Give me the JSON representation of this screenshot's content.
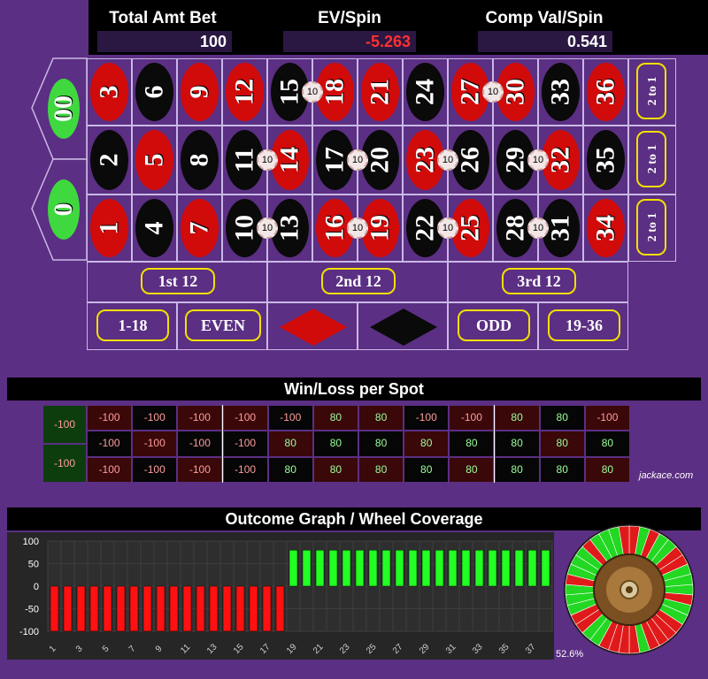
{
  "header": {
    "total_label": "Total Amt Bet",
    "total_value": "100",
    "ev_label": "EV/Spin",
    "ev_value": "-5.263",
    "comp_label": "Comp Val/Spin",
    "comp_value": "0.541"
  },
  "table": {
    "zeros": [
      "00",
      "0"
    ],
    "columns": [
      [
        {
          "n": "3",
          "c": "red"
        },
        {
          "n": "2",
          "c": "black"
        },
        {
          "n": "1",
          "c": "red"
        }
      ],
      [
        {
          "n": "6",
          "c": "black"
        },
        {
          "n": "5",
          "c": "red"
        },
        {
          "n": "4",
          "c": "black"
        }
      ],
      [
        {
          "n": "9",
          "c": "red"
        },
        {
          "n": "8",
          "c": "black"
        },
        {
          "n": "7",
          "c": "red"
        }
      ],
      [
        {
          "n": "12",
          "c": "red"
        },
        {
          "n": "11",
          "c": "black"
        },
        {
          "n": "10",
          "c": "black"
        }
      ],
      [
        {
          "n": "15",
          "c": "black"
        },
        {
          "n": "14",
          "c": "red"
        },
        {
          "n": "13",
          "c": "black"
        }
      ],
      [
        {
          "n": "18",
          "c": "red"
        },
        {
          "n": "17",
          "c": "black"
        },
        {
          "n": "16",
          "c": "red"
        }
      ],
      [
        {
          "n": "21",
          "c": "red"
        },
        {
          "n": "20",
          "c": "black"
        },
        {
          "n": "19",
          "c": "red"
        }
      ],
      [
        {
          "n": "24",
          "c": "black"
        },
        {
          "n": "23",
          "c": "red"
        },
        {
          "n": "22",
          "c": "black"
        }
      ],
      [
        {
          "n": "27",
          "c": "red"
        },
        {
          "n": "26",
          "c": "black"
        },
        {
          "n": "25",
          "c": "red"
        }
      ],
      [
        {
          "n": "30",
          "c": "red"
        },
        {
          "n": "29",
          "c": "black"
        },
        {
          "n": "28",
          "c": "black"
        }
      ],
      [
        {
          "n": "33",
          "c": "black"
        },
        {
          "n": "32",
          "c": "red"
        },
        {
          "n": "31",
          "c": "black"
        }
      ],
      [
        {
          "n": "36",
          "c": "red"
        },
        {
          "n": "35",
          "c": "black"
        },
        {
          "n": "34",
          "c": "red"
        }
      ]
    ],
    "column_bets": [
      "2 to 1",
      "2 to 1",
      "2 to 1"
    ],
    "dozens": [
      "1st 12",
      "2nd 12",
      "3rd 12"
    ],
    "outside": [
      "1-18",
      "EVEN",
      "ODD",
      "19-36"
    ],
    "chip_label": "10",
    "chips": [
      {
        "col": 5,
        "row": 0.5,
        "label": "10"
      },
      {
        "col": 9,
        "row": 0.5,
        "label": "10"
      },
      {
        "col": 4,
        "row": 1.5,
        "label": "10"
      },
      {
        "col": 6,
        "row": 1.5,
        "label": "10"
      },
      {
        "col": 8,
        "row": 1.5,
        "label": "10"
      },
      {
        "col": 10,
        "row": 1.5,
        "label": "10"
      },
      {
        "col": 4,
        "row": 2.5,
        "label": "10"
      },
      {
        "col": 6,
        "row": 2.5,
        "label": "10"
      },
      {
        "col": 8,
        "row": 2.5,
        "label": "10"
      },
      {
        "col": 10,
        "row": 2.5,
        "label": "10"
      }
    ]
  },
  "winloss": {
    "title": "Win/Loss per Spot",
    "zeros": [
      "-100",
      "-100"
    ],
    "rows": [
      [
        "-100",
        "-100",
        "-100",
        "-100",
        "-100",
        "80",
        "80",
        "-100",
        "-100",
        "80",
        "80",
        "-100"
      ],
      [
        "-100",
        "-100",
        "-100",
        "-100",
        "80",
        "80",
        "80",
        "80",
        "80",
        "80",
        "80",
        "80"
      ],
      [
        "-100",
        "-100",
        "-100",
        "-100",
        "80",
        "80",
        "80",
        "80",
        "80",
        "80",
        "80",
        "80"
      ]
    ],
    "credit": "jackace.com",
    "colors": {
      "win_text": "#9cff9c",
      "loss_text": "#ff9c9c",
      "zero_bg": "#0d3d0d"
    }
  },
  "outcome": {
    "title": "Outcome Graph / Wheel Coverage",
    "wheel_pct": "52.6%"
  },
  "chart_data": {
    "type": "bar",
    "title": "Outcome Graph / Wheel Coverage",
    "x": [
      1,
      2,
      3,
      4,
      5,
      6,
      7,
      8,
      9,
      10,
      11,
      12,
      13,
      14,
      15,
      16,
      17,
      18,
      19,
      20,
      21,
      22,
      23,
      24,
      25,
      26,
      27,
      28,
      29,
      30,
      31,
      32,
      33,
      34,
      35,
      36,
      37,
      38
    ],
    "values": [
      -100,
      -100,
      -100,
      -100,
      -100,
      -100,
      -100,
      -100,
      -100,
      -100,
      -100,
      -100,
      -100,
      -100,
      -100,
      -100,
      -100,
      -100,
      80,
      80,
      80,
      80,
      80,
      80,
      80,
      80,
      80,
      80,
      80,
      80,
      80,
      80,
      80,
      80,
      80,
      80,
      80,
      80
    ],
    "x_ticks": [
      "1",
      "3",
      "5",
      "7",
      "9",
      "11",
      "13",
      "15",
      "17",
      "19",
      "21",
      "23",
      "25",
      "27",
      "29",
      "31",
      "33",
      "35",
      "37"
    ],
    "y_ticks": [
      "100",
      "50",
      "0",
      "-50",
      "-100"
    ],
    "ylim": [
      -100,
      100
    ],
    "grid": true,
    "colors": {
      "positive": "#22ff22",
      "negative": "#ff1111"
    }
  }
}
